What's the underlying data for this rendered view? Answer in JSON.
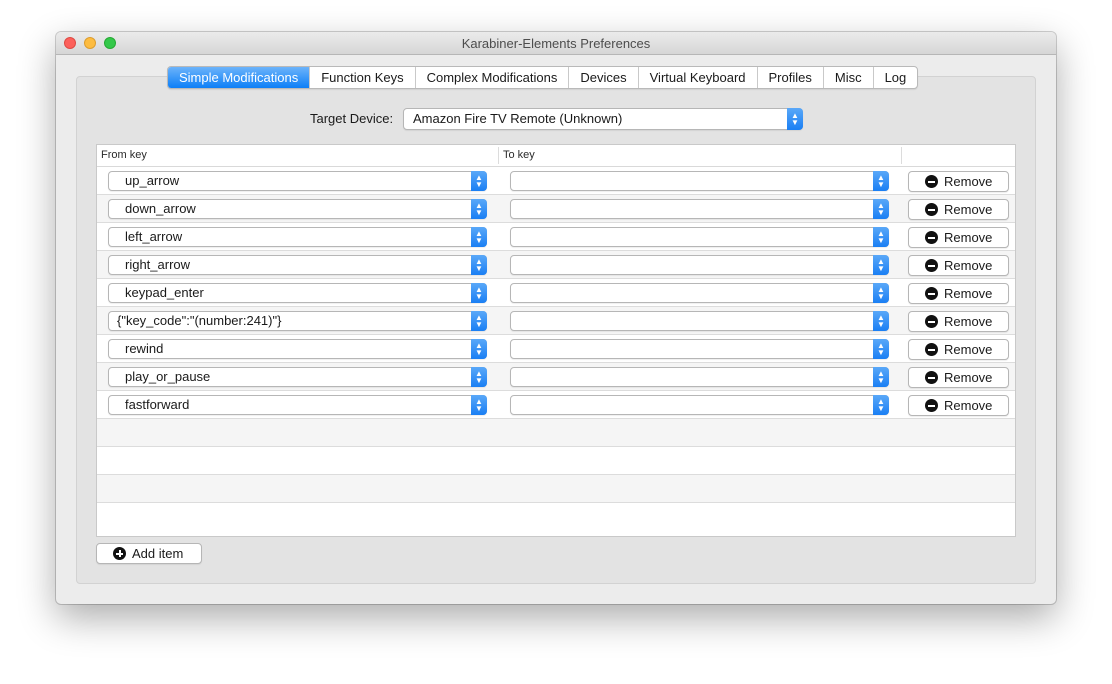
{
  "window": {
    "title": "Karabiner-Elements Preferences"
  },
  "tabs": [
    {
      "label": "Simple Modifications",
      "active": true
    },
    {
      "label": "Function Keys",
      "active": false
    },
    {
      "label": "Complex Modifications",
      "active": false
    },
    {
      "label": "Devices",
      "active": false
    },
    {
      "label": "Virtual Keyboard",
      "active": false
    },
    {
      "label": "Profiles",
      "active": false
    },
    {
      "label": "Misc",
      "active": false
    },
    {
      "label": "Log",
      "active": false
    }
  ],
  "target_device": {
    "label": "Target Device:",
    "value": "Amazon Fire TV Remote (Unknown)"
  },
  "table": {
    "from_header": "From key",
    "to_header": "To key",
    "remove_label": "Remove",
    "rows": [
      {
        "from": "up_arrow",
        "to": ""
      },
      {
        "from": "down_arrow",
        "to": ""
      },
      {
        "from": "left_arrow",
        "to": ""
      },
      {
        "from": "right_arrow",
        "to": ""
      },
      {
        "from": "keypad_enter",
        "to": ""
      },
      {
        "from": "{\"key_code\":\"(number:241)\"}",
        "to": ""
      },
      {
        "from": "rewind",
        "to": ""
      },
      {
        "from": "play_or_pause",
        "to": ""
      },
      {
        "from": "fastforward",
        "to": ""
      }
    ]
  },
  "add_item_label": "Add item",
  "colors": {
    "accent": "#1a7ff4",
    "window_bg": "#ececec"
  }
}
